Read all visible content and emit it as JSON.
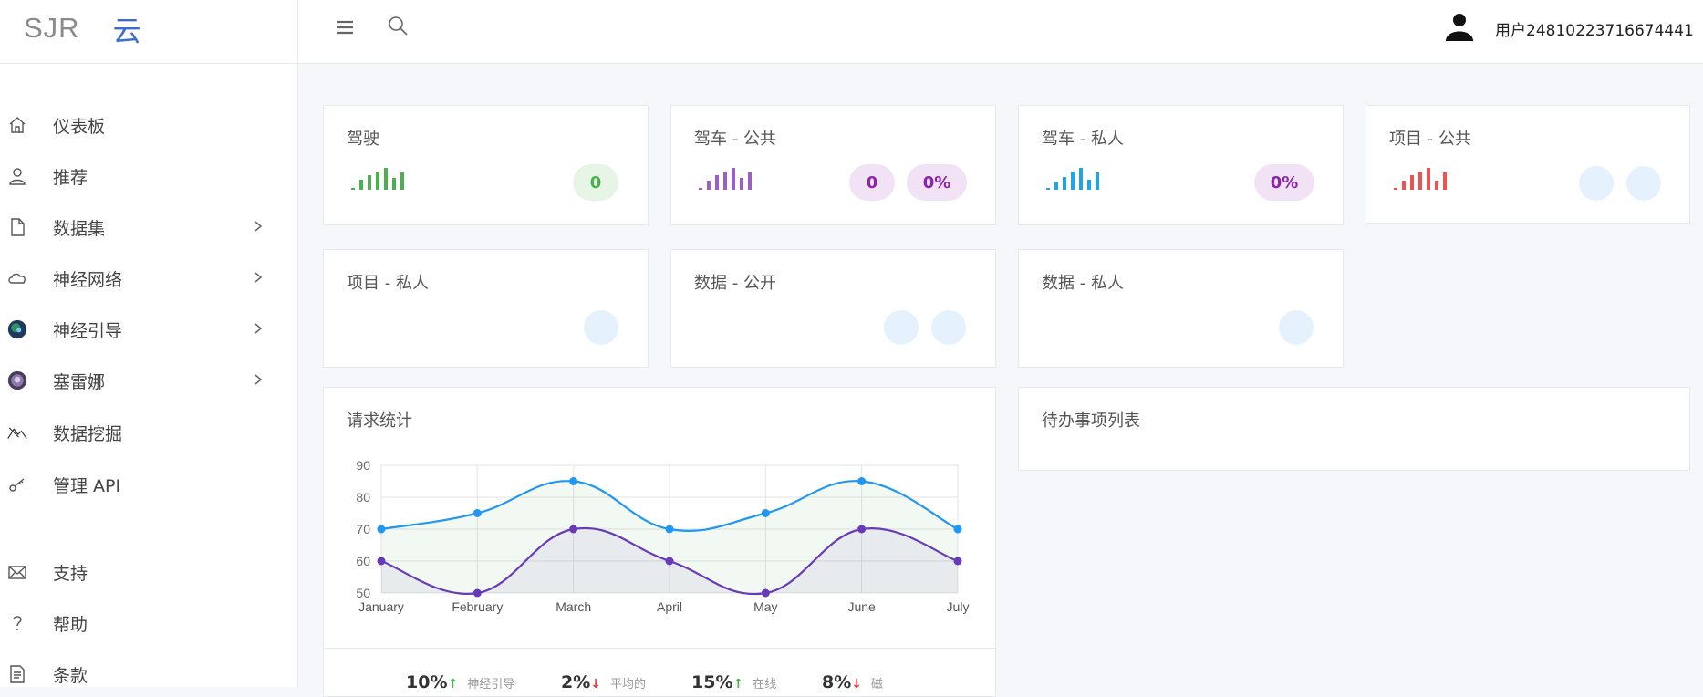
{
  "brand": {
    "logo_text": "SJR",
    "logo_suffix": "云"
  },
  "sidebar": {
    "items": [
      {
        "label": "仪表板",
        "icon": "home-icon",
        "expandable": false
      },
      {
        "label": "推荐",
        "icon": "user-icon",
        "expandable": false
      },
      {
        "label": "数据集",
        "icon": "file-icon",
        "expandable": true
      },
      {
        "label": "神经网络",
        "icon": "cloud-icon",
        "expandable": true
      },
      {
        "label": "神经引导",
        "icon": "brain-image-icon",
        "expandable": true
      },
      {
        "label": "塞雷娜",
        "icon": "serena-image-icon",
        "expandable": true
      },
      {
        "label": "数据挖掘",
        "icon": "mountain-icon",
        "expandable": false
      },
      {
        "label": "管理 API",
        "icon": "key-icon",
        "expandable": false
      },
      {
        "label": "支持",
        "icon": "mail-icon",
        "expandable": false
      },
      {
        "label": "帮助",
        "icon": "question-icon",
        "expandable": false
      },
      {
        "label": "条款",
        "icon": "document-icon",
        "expandable": false
      }
    ]
  },
  "header": {
    "user_name": "用户24810223716674441"
  },
  "cards": {
    "driving": {
      "title": "驾驶",
      "value": "0"
    },
    "carpool_public": {
      "title": "驾车 - 公共",
      "value": "0",
      "percent": "0%"
    },
    "carpool_private": {
      "title": "驾车 - 私人",
      "percent": "0%"
    },
    "project_public": {
      "title": "项目 - 公共"
    },
    "project_private": {
      "title": "项目 - 私人"
    },
    "data_public": {
      "title": "数据 - 公开"
    },
    "data_private": {
      "title": "数据 - 私人"
    },
    "request_stats": {
      "title": "请求统计"
    },
    "todo": {
      "title": "待办事项列表"
    }
  },
  "colors": {
    "green": "#4caf50",
    "purple": "#9c5fc4",
    "blue": "#1fa4e4",
    "red": "#ef5350",
    "series_blue": "#2196f3",
    "series_purple": "#673ab7"
  },
  "chart_data": {
    "type": "line",
    "categories": [
      "January",
      "February",
      "March",
      "April",
      "May",
      "June",
      "July"
    ],
    "series": [
      {
        "values": [
          70,
          75,
          85,
          70,
          75,
          85,
          70
        ],
        "color": "#2196f3"
      },
      {
        "values": [
          60,
          50,
          70,
          60,
          50,
          70,
          60
        ],
        "color": "#673ab7"
      }
    ],
    "yticks": [
      50,
      60,
      70,
      80,
      90
    ],
    "ylim": [
      50,
      90
    ],
    "grid": true
  },
  "stats": [
    {
      "value": "10%",
      "trend": "up",
      "label": "神经引导"
    },
    {
      "value": "2%",
      "trend": "down",
      "label": "平均的"
    },
    {
      "value": "15%",
      "trend": "up",
      "label": "在线"
    },
    {
      "value": "8%",
      "trend": "down",
      "label": "磁"
    }
  ]
}
